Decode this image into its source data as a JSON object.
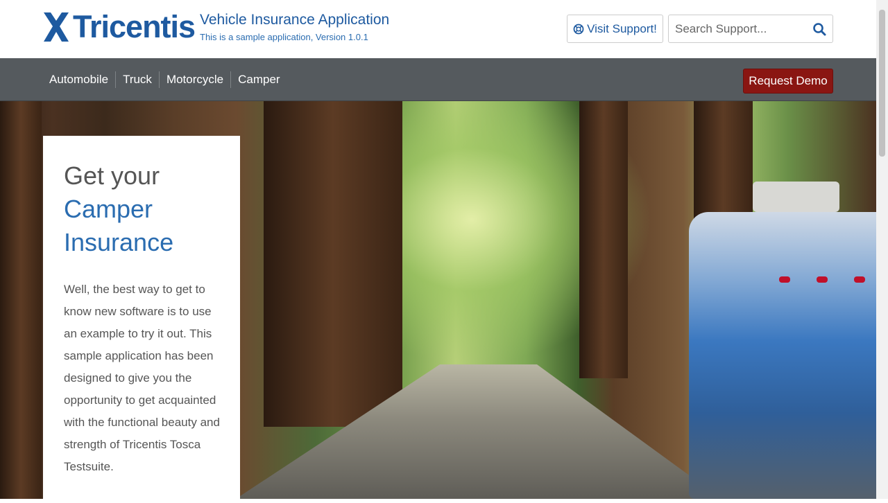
{
  "header": {
    "logo_text": "Tricentis",
    "app_title": "Vehicle Insurance Application",
    "app_subtitle": "This is a sample application, Version 1.0.1",
    "support_label": "Visit Support!",
    "search_placeholder": "Search Support..."
  },
  "nav": {
    "items": [
      {
        "label": "Automobile"
      },
      {
        "label": "Truck"
      },
      {
        "label": "Motorcycle"
      },
      {
        "label": "Camper"
      }
    ],
    "demo_label": "Request Demo"
  },
  "card": {
    "heading_line1": "Get your",
    "heading_line2": "Camper",
    "heading_line3": "Insurance",
    "body": "Well, the best way to get to know new software is to use an example to try it out. This sample application has been designed to give you the opportunity to get acquainted with the functional beauty and strength of Tricentis Tosca Testsuite."
  },
  "colors": {
    "brand_blue": "#1e5aa0",
    "nav_bg": "#555a5e",
    "demo_red": "#8a1612"
  },
  "icons": {
    "logo": "tricentis-x-icon",
    "support": "lifebuoy-icon",
    "search": "search-icon"
  }
}
